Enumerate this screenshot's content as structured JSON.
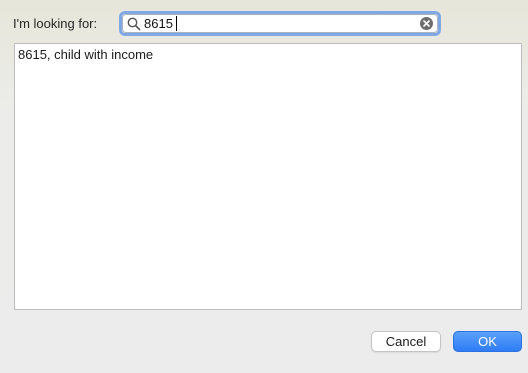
{
  "search": {
    "label": "I'm looking for:",
    "value": "8615",
    "placeholder": ""
  },
  "results": {
    "items": [
      {
        "label": "8615, child with income"
      }
    ]
  },
  "buttons": {
    "cancel_label": "Cancel",
    "ok_label": "OK"
  },
  "icons": {
    "search": "search-icon",
    "clear": "clear-icon"
  },
  "colors": {
    "accent": "#2f7cf6",
    "focus_ring": "#7fa8e3"
  }
}
